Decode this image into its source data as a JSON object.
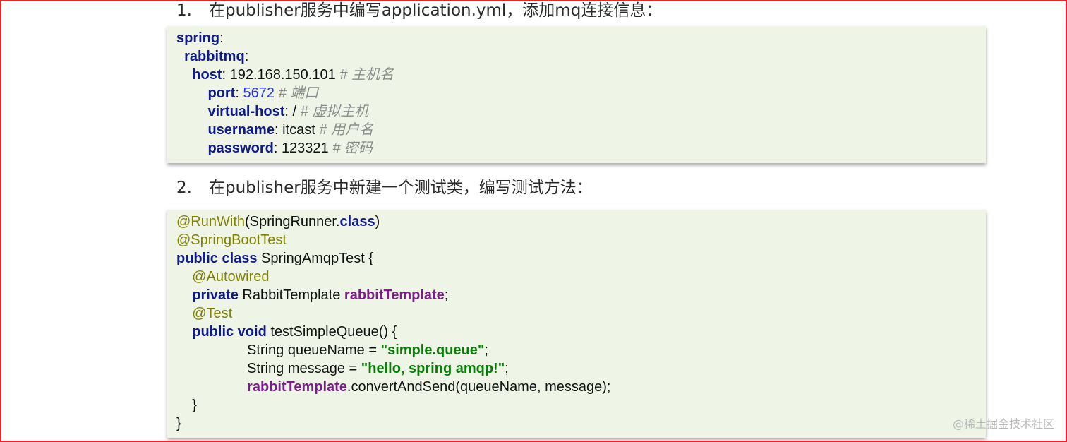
{
  "steps": [
    {
      "number": "1.",
      "text": "在publisher服务中编写application.yml，添加mq连接信息："
    },
    {
      "number": "2.",
      "text": "在publisher服务中新建一个测试类，编写测试方法："
    }
  ],
  "yaml": {
    "spring": "spring",
    "rabbitmq": "rabbitmq",
    "host_key": "host",
    "host_value": "192.168.150.101",
    "host_comment": "# 主机名",
    "port_key": "port",
    "port_value": "5672",
    "port_comment": "# 端口",
    "vhost_key": "virtual-host",
    "vhost_value": "/",
    "vhost_comment": "# 虚拟主机",
    "username_key": "username",
    "username_value": "itcast",
    "username_comment": "# 用户名",
    "password_key": "password",
    "password_value": "123321",
    "password_comment": "# 密码"
  },
  "java": {
    "ann_runwith": "@RunWith",
    "runwith_arg": "(SpringRunner.",
    "class_kw": "class",
    "close_paren": ")",
    "ann_springboottest": "@SpringBootTest",
    "public_class": "public class",
    "class_name": " SpringAmqpTest {",
    "ann_autowired": "@Autowired",
    "private_kw": "private",
    "template_type": " RabbitTemplate ",
    "template_field": "rabbitTemplate",
    "semicolon": ";",
    "ann_test": "@Test",
    "public_void": "public void",
    "method_sig": " testSimpleQueue() {",
    "queue_decl": "String queueName = ",
    "queue_str": "\"simple.queue\"",
    "msg_decl": "String message = ",
    "msg_str": "\"hello, spring amqp!\"",
    "call_field": "rabbitTemplate",
    "call_rest": ".convertAndSend(queueName, message);",
    "close_method": "}",
    "close_class": "}"
  },
  "watermark": "@稀土掘金技术社区"
}
